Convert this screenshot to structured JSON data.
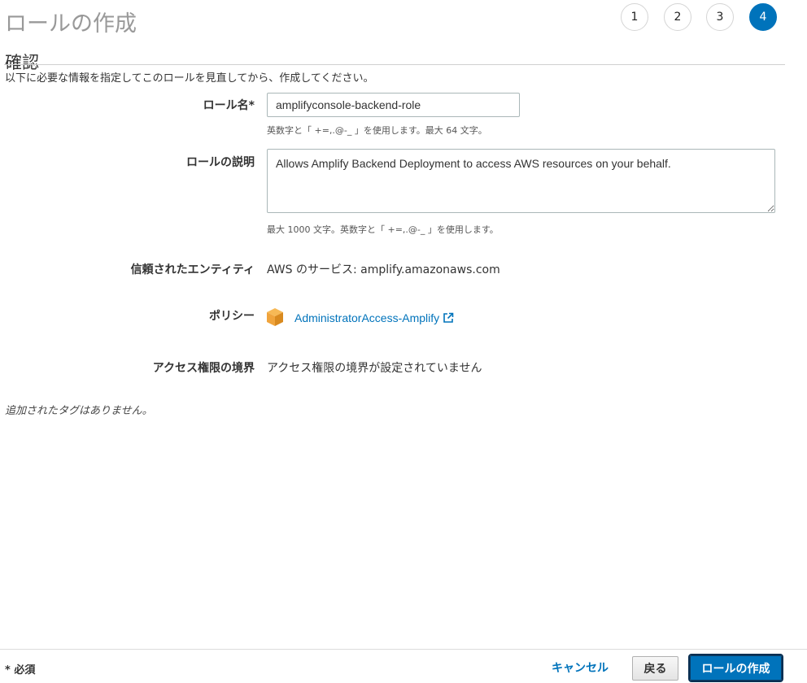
{
  "page": {
    "title": "ロールの作成"
  },
  "steps": [
    {
      "label": "1",
      "active": false
    },
    {
      "label": "2",
      "active": false
    },
    {
      "label": "3",
      "active": false
    },
    {
      "label": "4",
      "active": true
    }
  ],
  "section": {
    "title": "確認",
    "intro": "以下に必要な情報を指定してこのロールを見直してから、作成してください。"
  },
  "form": {
    "role_name": {
      "label": "ロール名*",
      "value": "amplifyconsole-backend-role",
      "hint": "英数字と「 +=,.@-_ 」を使用します。最大 64 文字。"
    },
    "role_description": {
      "label": "ロールの説明",
      "value": "Allows Amplify Backend Deployment to access AWS resources on your behalf.",
      "hint": "最大 1000 文字。英数字と「 +=,.@-_ 」を使用します。"
    },
    "trusted_entity": {
      "label": "信頼されたエンティティ",
      "value": "AWS のサービス: amplify.amazonaws.com"
    },
    "policy": {
      "label": "ポリシー",
      "link_text": "AdministratorAccess-Amplify",
      "icon": "aws-managed-policy-cube-icon",
      "icon_color": "#f0a43c"
    },
    "permissions_boundary": {
      "label": "アクセス権限の境界",
      "value": "アクセス権限の境界が設定されていません"
    }
  },
  "tags": {
    "empty_text": "追加されたタグはありません。"
  },
  "footer": {
    "required_note": "* 必須",
    "cancel_label": "キャンセル",
    "back_label": "戻る",
    "create_label": "ロールの作成"
  },
  "colors": {
    "accent": "#0073bb",
    "link": "#0073bb"
  }
}
